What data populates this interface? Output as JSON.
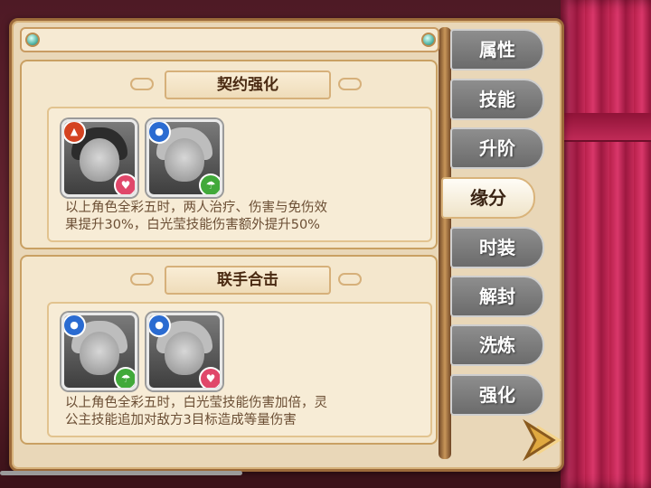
{
  "tabs": [
    {
      "label": "属性",
      "active": false
    },
    {
      "label": "技能",
      "active": false
    },
    {
      "label": "升阶",
      "active": false
    },
    {
      "label": "缘分",
      "active": true
    },
    {
      "label": "时装",
      "active": false
    },
    {
      "label": "解封",
      "active": false
    },
    {
      "label": "洗炼",
      "active": false
    },
    {
      "label": "强化",
      "active": false
    }
  ],
  "bonds": [
    {
      "title": "契约强化",
      "heroes": [
        {
          "element": "fire",
          "badge": "heart"
        },
        {
          "element": "water",
          "badge": "umbrella"
        }
      ],
      "description_line1": "以上角色全彩五时，两人治疗、伤害与免伤效",
      "description_line2": "果提升30%，白光莹技能伤害额外提升50%"
    },
    {
      "title": "联手合击",
      "heroes": [
        {
          "element": "water",
          "badge": "umbrella"
        },
        {
          "element": "water",
          "badge": "heart"
        }
      ],
      "description_line1": "以上角色全彩五时，白光莹技能伤害加倍，灵",
      "description_line2": "公主技能追加对敌方3目标造成等量伤害"
    }
  ],
  "colors": {
    "panel": "#e9d7b8",
    "frame": "#9c6a3a",
    "curtain": "#c52a58",
    "text": "#6b4e34",
    "title": "#4a2a12"
  }
}
